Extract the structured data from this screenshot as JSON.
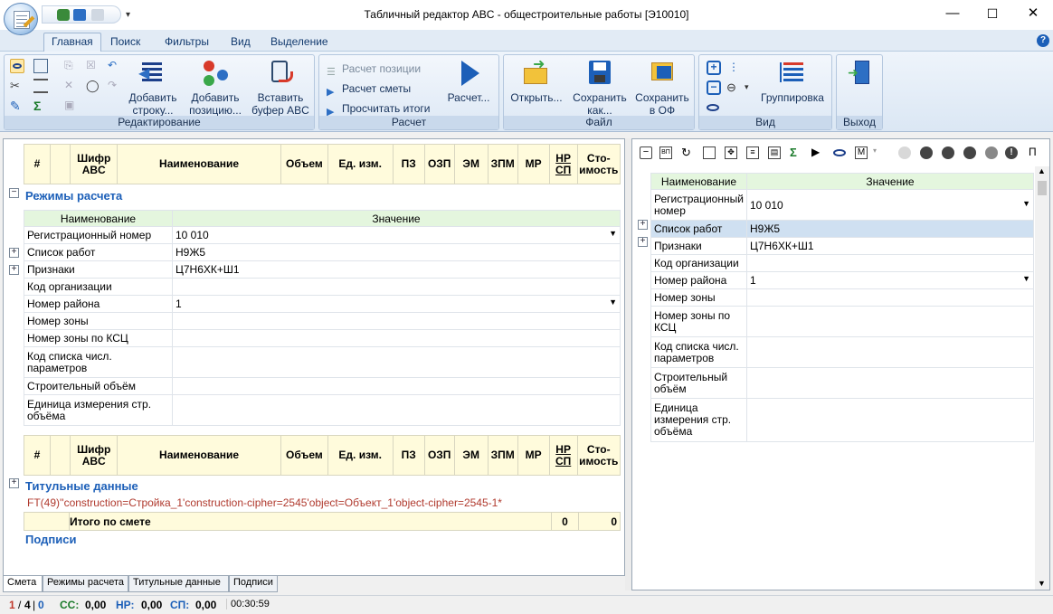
{
  "window": {
    "title": "Табличный редактор ABC - общестроительные работы [Э10010]"
  },
  "tabs": [
    "Главная",
    "Поиск",
    "Фильтры",
    "Вид",
    "Выделение"
  ],
  "ribbon": {
    "edit_group": "Редактирование",
    "add_row": "Добавить строку...",
    "add_pos": "Добавить позицию...",
    "insert_buf": "Вставить буфер ABC",
    "calc_group": "Расчет",
    "calc_pos": "Расчет позиции",
    "calc_est": "Расчет сметы",
    "calc_totals": "Просчитать итоги",
    "calc_btn": "Расчет...",
    "file_group": "Файл",
    "open": "Открыть...",
    "save_as": "Сохранить как...",
    "save_of": "Сохранить в ОФ",
    "view_group": "Вид",
    "grouping": "Группировка",
    "exit_group": "Выход"
  },
  "grid": {
    "columns": [
      "#",
      "",
      "Шифр ABC",
      "Наименование",
      "Объем",
      "Ед. изм.",
      "ПЗ",
      "ОЗП",
      "ЭМ",
      "ЗПМ",
      "МР",
      "НР СП",
      "Сто-имость"
    ]
  },
  "left": {
    "section_modes": "Режимы расчета",
    "prop_head_name": "Наименование",
    "prop_head_value": "Значение",
    "props": [
      {
        "name": "Регистрационный номер",
        "value": "10 010"
      },
      {
        "name": "Список работ",
        "value": "Н9Ж5"
      },
      {
        "name": "Признаки",
        "value": "Ц7Н6ХК+Ш1"
      },
      {
        "name": "Код организации",
        "value": ""
      },
      {
        "name": "Номер района",
        "value": "1"
      },
      {
        "name": "Номер зоны",
        "value": ""
      },
      {
        "name": "Номер зоны по КСЦ",
        "value": ""
      },
      {
        "name": "Код списка числ. параметров",
        "value": ""
      },
      {
        "name": "Строительный объём",
        "value": ""
      },
      {
        "name": "Единица измерения стр. объёма",
        "value": ""
      }
    ],
    "section_title": "Титульные данные",
    "ft_line": "FT(49)''construction=Стройка_1'construction-cipher=2545'object=Объект_1'object-cipher=2545-1*",
    "total_label": "Итого по смете",
    "total_a": "0",
    "total_b": "0",
    "section_sign": "Подписи"
  },
  "right": {
    "head_name": "Наименование",
    "head_value": "Значение",
    "props": [
      {
        "name": "Регистрационный номер",
        "value": "10 010"
      },
      {
        "name": "Список работ",
        "value": "Н9Ж5"
      },
      {
        "name": "Признаки",
        "value": "Ц7Н6ХК+Ш1"
      },
      {
        "name": "Код организации",
        "value": ""
      },
      {
        "name": "Номер района",
        "value": "1"
      },
      {
        "name": "Номер зоны",
        "value": ""
      },
      {
        "name": "Номер зоны по КСЦ",
        "value": ""
      },
      {
        "name": "Код списка числ. параметров",
        "value": ""
      },
      {
        "name": "Строительный объём",
        "value": ""
      },
      {
        "name": "Единица измерения стр. объёма",
        "value": ""
      }
    ]
  },
  "bottom_tabs": [
    "Смета",
    "Режимы расчета",
    "Титульные данные",
    "Подписи"
  ],
  "status": {
    "page_cur": "1",
    "page_total": "4",
    "page_zero": "0",
    "cc_label": "СС:",
    "cc": "0,00",
    "hp_label": "НР:",
    "hp": "0,00",
    "sp_label": "СП:",
    "sp": "0,00",
    "time": "00:30:59"
  }
}
